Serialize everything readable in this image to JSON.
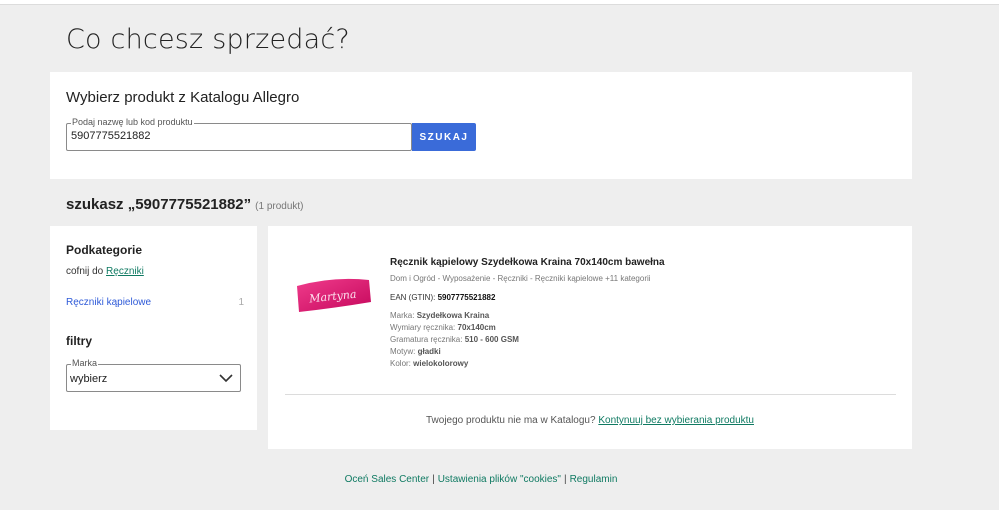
{
  "page": {
    "title": "Co chcesz sprzedać?"
  },
  "catalog": {
    "title": "Wybierz produkt z Katalogu Allegro",
    "search_placeholder": "Podaj nazwę lub kod produktu",
    "search_value": "5907775521882",
    "search_button": "SZUKAJ"
  },
  "results": {
    "heading": "szukasz „5907775521882”",
    "count": "(1 produkt)"
  },
  "sidebar": {
    "subcategories_title": "Podkategorie",
    "back_prefix": "cofnij do",
    "back_link": "Ręczniki",
    "items": [
      {
        "label": "Ręczniki kąpielowe",
        "count": "1"
      }
    ],
    "filters_title": "filtry",
    "brand_label": "Marka",
    "brand_value": "wybierz"
  },
  "product": {
    "name": "Ręcznik kąpielowy Szydełkowa Kraina 70x140cm bawełna",
    "path": "Dom i Ogród - Wyposażenie - Ręczniki - Ręczniki kąpielowe +11 kategorii",
    "ean_label": "EAN (GTIN):",
    "ean_value": "5907775521882",
    "image_text": "Martyna",
    "image_color": "#e0136f",
    "attributes": [
      {
        "label": "Marka:",
        "value": "Szydełkowa Kraina"
      },
      {
        "label": "Wymiary ręcznika:",
        "value": "70x140cm"
      },
      {
        "label": "Gramatura ręcznika:",
        "value": "510 - 600 GSM"
      },
      {
        "label": "Motyw:",
        "value": "gładki"
      },
      {
        "label": "Kolor:",
        "value": "wielokolorowy"
      }
    ]
  },
  "missing": {
    "text": "Twojego produktu nie ma w Katalogu?",
    "link": "Kontynuuj bez wybierania produktu"
  },
  "footer": {
    "links": [
      "Oceń Sales Center",
      "Ustawienia plików \"cookies\"",
      "Regulamin"
    ],
    "separator": "|"
  },
  "colors": {
    "accent_button": "#3a6bd9",
    "link_green": "#0f7a62",
    "link_blue": "#2e5ad8"
  }
}
